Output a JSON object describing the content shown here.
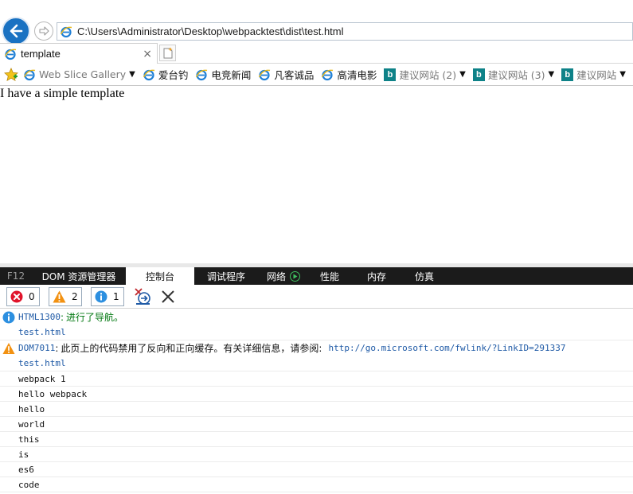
{
  "address_bar": {
    "url": "C:\\Users\\Administrator\\Desktop\\webpacktest\\dist\\test.html"
  },
  "tab": {
    "title": "template",
    "close_glyph": "×"
  },
  "favorites": [
    {
      "label": "Web Slice Gallery",
      "icon": "ie-icon",
      "dropdown": true,
      "grey": true
    },
    {
      "label": "爱台钓",
      "icon": "ie-icon",
      "dropdown": false,
      "grey": false
    },
    {
      "label": "电竞新闻",
      "icon": "ie-icon",
      "dropdown": false,
      "grey": false
    },
    {
      "label": "凡客诚品",
      "icon": "ie-icon",
      "dropdown": false,
      "grey": false
    },
    {
      "label": "高清电影",
      "icon": "ie-icon",
      "dropdown": false,
      "grey": false
    },
    {
      "label": "建议网站 (2)",
      "icon": "bing-icon",
      "dropdown": true,
      "grey": true
    },
    {
      "label": "建议网站 (3)",
      "icon": "bing-icon",
      "dropdown": true,
      "grey": true
    },
    {
      "label": "建议网站",
      "icon": "bing-icon",
      "dropdown": true,
      "grey": true
    }
  ],
  "page": {
    "text": "I have a simple template"
  },
  "devtools": {
    "tabs": [
      {
        "label": "F12"
      },
      {
        "label": "DOM 资源管理器"
      },
      {
        "label": "控制台"
      },
      {
        "label": "调试程序"
      },
      {
        "label": "网络"
      },
      {
        "label": "性能"
      },
      {
        "label": "内存"
      },
      {
        "label": "仿真"
      }
    ],
    "active_tab": "控制台",
    "counts": {
      "errors": "0",
      "warnings": "2",
      "info": "1"
    },
    "colors": {
      "error": "#e0142b",
      "warning": "#f29111",
      "info": "#2c8fe0"
    },
    "messages": [
      {
        "type": "info",
        "code": "HTML1300",
        "separator": ":",
        "text": "进行了导航。",
        "source": "test.html"
      },
      {
        "type": "warning",
        "code": "DOM7011",
        "separator": ":",
        "text": "此页上的代码禁用了反向和正向缓存。有关详细信息，请参阅:",
        "link": "http://go.microsoft.com/fwlink/?LinkID=291337",
        "source": "test.html"
      }
    ],
    "logs": [
      "webpack 1",
      "hello webpack",
      "hello",
      "world",
      "this",
      "is",
      "es6",
      "code"
    ]
  }
}
